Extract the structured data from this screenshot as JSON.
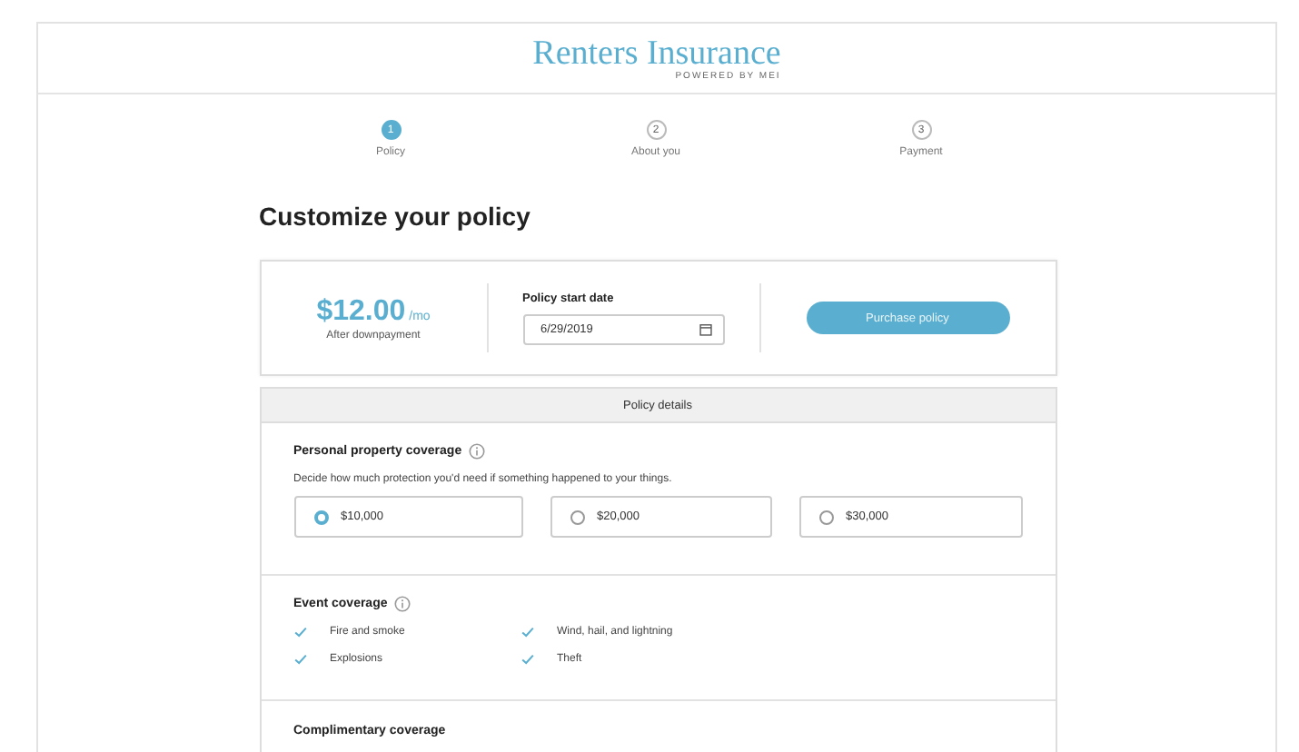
{
  "header": {
    "logo": "Renters Insurance",
    "powered_by": "POWERED BY MEI"
  },
  "steps": [
    {
      "number": "1",
      "label": "Policy",
      "selected": true
    },
    {
      "number": "2",
      "label": "About you",
      "selected": false
    },
    {
      "number": "3",
      "label": "Payment",
      "selected": false
    }
  ],
  "heading": "Customize your policy",
  "summary": {
    "price": "$12.00",
    "unit": "/mo",
    "price_note": "After downpayment",
    "date_label": "Policy start date",
    "date_value": "6/29/2019",
    "button": "Purchase policy"
  },
  "details": {
    "title": "Policy details",
    "sections": [
      {
        "kind": "options",
        "title": "Personal property coverage",
        "info": true,
        "description": "Decide how much protection you'd need if something happened to your things.",
        "options": [
          {
            "label": "$10,000",
            "selected": true
          },
          {
            "label": "$20,000",
            "selected": false
          },
          {
            "label": "$30,000",
            "selected": false
          }
        ]
      },
      {
        "kind": "checklist",
        "title": "Event coverage",
        "info": true,
        "items": [
          "Fire and smoke",
          "Wind, hail, and lightning",
          "Explosions",
          "Theft"
        ]
      },
      {
        "kind": "heading",
        "title": "Complimentary coverage",
        "info": false
      }
    ]
  }
}
